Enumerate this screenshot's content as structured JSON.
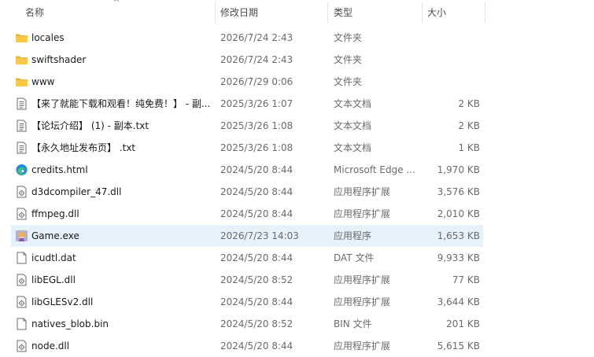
{
  "header": {
    "name_label": "名称",
    "date_label": "修改日期",
    "type_label": "类型",
    "size_label": "大小",
    "sort_indicator": "^"
  },
  "files": [
    {
      "name": "locales",
      "date": "2026/7/24 2:43",
      "type": "文件夹",
      "size": "",
      "icon": "folder-icon"
    },
    {
      "name": "swiftshader",
      "date": "2026/7/24 2:43",
      "type": "文件夹",
      "size": "",
      "icon": "folder-icon"
    },
    {
      "name": "www",
      "date": "2026/7/29 0:06",
      "type": "文件夹",
      "size": "",
      "icon": "folder-icon"
    },
    {
      "name": "【来了就能下载和观看！纯免费！】 - 副...",
      "date": "2025/3/26 1:07",
      "type": "文本文档",
      "size": "2 KB",
      "icon": "text-file-icon"
    },
    {
      "name": "【论坛介绍】 (1) - 副本.txt",
      "date": "2025/3/26 1:08",
      "type": "文本文档",
      "size": "2 KB",
      "icon": "text-file-icon"
    },
    {
      "name": "【永久地址发布页】 .txt",
      "date": "2025/3/26 1:08",
      "type": "文本文档",
      "size": "1 KB",
      "icon": "text-file-icon"
    },
    {
      "name": "credits.html",
      "date": "2024/5/20 8:44",
      "type": "Microsoft Edge ...",
      "size": "1,970 KB",
      "icon": "edge-icon"
    },
    {
      "name": "d3dcompiler_47.dll",
      "date": "2024/5/20 8:44",
      "type": "应用程序扩展",
      "size": "3,576 KB",
      "icon": "dll-file-icon"
    },
    {
      "name": "ffmpeg.dll",
      "date": "2024/5/20 8:44",
      "type": "应用程序扩展",
      "size": "2,010 KB",
      "icon": "dll-file-icon"
    },
    {
      "name": "Game.exe",
      "date": "2026/7/23 14:03",
      "type": "应用程序",
      "size": "1,653 KB",
      "icon": "game-exe-icon"
    },
    {
      "name": "icudtl.dat",
      "date": "2024/5/20 8:44",
      "type": "DAT 文件",
      "size": "9,933 KB",
      "icon": "blank-file-icon"
    },
    {
      "name": "libEGL.dll",
      "date": "2024/5/20 8:52",
      "type": "应用程序扩展",
      "size": "77 KB",
      "icon": "dll-file-icon"
    },
    {
      "name": "libGLESv2.dll",
      "date": "2024/5/20 8:44",
      "type": "应用程序扩展",
      "size": "3,644 KB",
      "icon": "dll-file-icon"
    },
    {
      "name": "natives_blob.bin",
      "date": "2024/5/20 8:52",
      "type": "BIN 文件",
      "size": "201 KB",
      "icon": "blank-file-icon"
    },
    {
      "name": "node.dll",
      "date": "2024/5/20 8:44",
      "type": "应用程序扩展",
      "size": "5,615 KB",
      "icon": "dll-file-icon"
    }
  ],
  "selected_file": "Game.exe",
  "colors": {
    "selection": "#e5f1fb",
    "folder": "#f8c94b",
    "edge": "#1d8ede"
  }
}
